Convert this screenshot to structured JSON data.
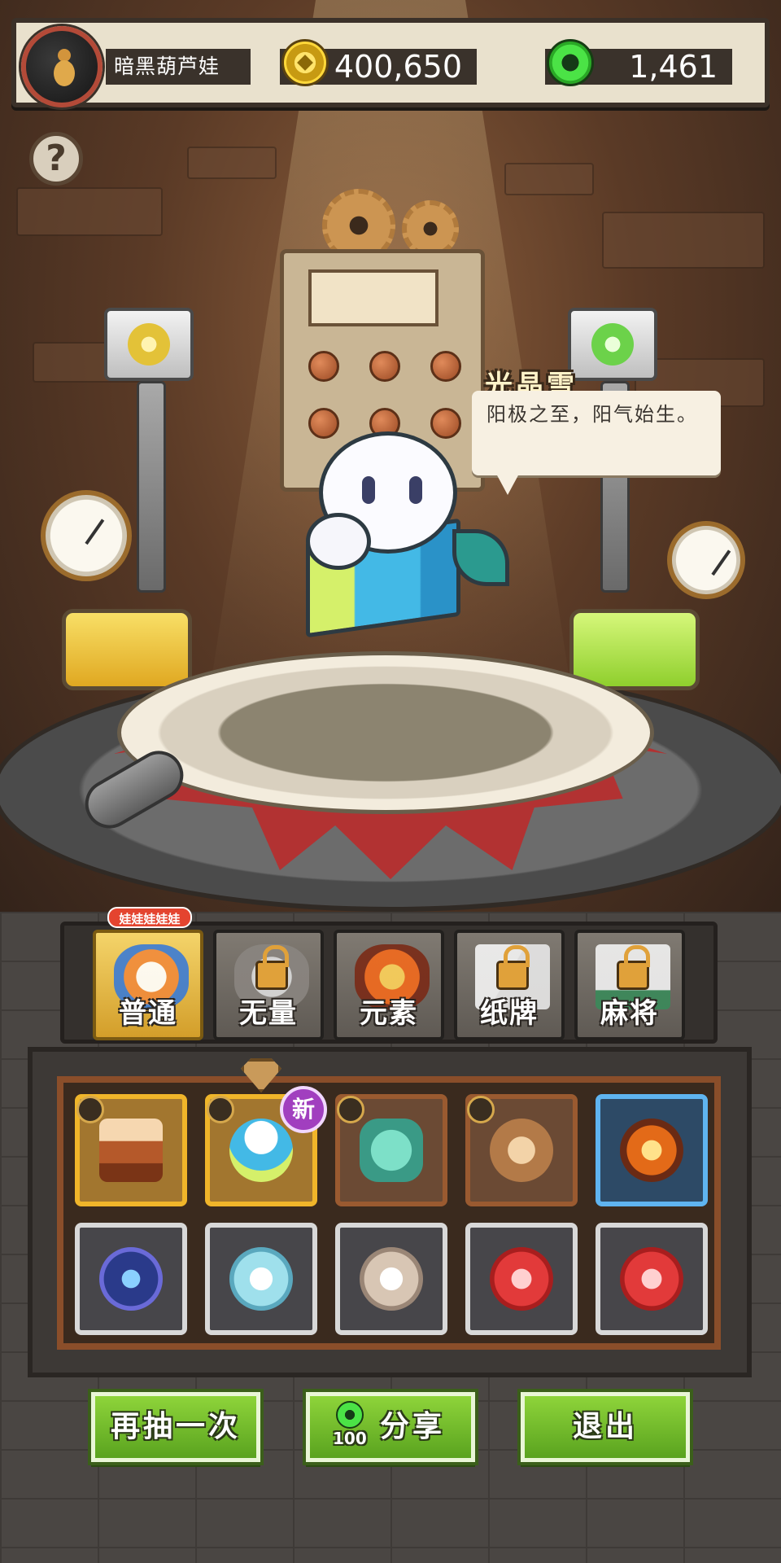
{
  "header": {
    "player_name": "暗黑葫芦娃",
    "gold": "400,650",
    "gems": "1,461"
  },
  "help": {
    "label": "?"
  },
  "character": {
    "name": "光晶雪",
    "quote": "阳极之至，阳气始生。"
  },
  "tabs": [
    {
      "label": "普通",
      "locked": false,
      "active": true,
      "badge": "娃娃娃娃娃"
    },
    {
      "label": "无量",
      "locked": true,
      "active": false
    },
    {
      "label": "元素",
      "locked": false,
      "active": false
    },
    {
      "label": "纸牌",
      "locked": true,
      "active": false
    },
    {
      "label": "麻将",
      "locked": true,
      "active": false
    }
  ],
  "results": {
    "new_badge": "新",
    "items": [
      {
        "name": "pudding-icon",
        "frame": "gold"
      },
      {
        "name": "crystal-ghost-icon",
        "frame": "gold",
        "is_new": true
      },
      {
        "name": "cannon-icon",
        "frame": "brown"
      },
      {
        "name": "monkey-icon",
        "frame": "brown"
      },
      {
        "name": "fire-orb-icon",
        "frame": "blue"
      },
      {
        "name": "blue-rune-icon",
        "frame": "grey"
      },
      {
        "name": "snowflake-icon",
        "frame": "grey"
      },
      {
        "name": "feather-icon",
        "frame": "grey"
      },
      {
        "name": "red-wing-icon",
        "frame": "grey"
      },
      {
        "name": "red-wing-icon",
        "frame": "grey"
      }
    ]
  },
  "buttons": {
    "retry": "再抽一次",
    "share": "分享",
    "share_cost": "100",
    "exit": "退出"
  },
  "colors": {
    "gold_frame": "#f0b52a",
    "button_green": "#6ebd2a",
    "tab_active": "#f4d46a"
  }
}
